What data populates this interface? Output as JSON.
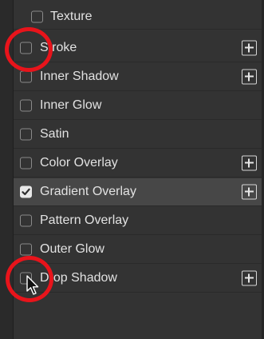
{
  "layer_style_list": {
    "items": [
      {
        "label": "Texture",
        "checked": false,
        "has_add": false,
        "selected": false,
        "sub": true
      },
      {
        "label": "Stroke",
        "checked": false,
        "has_add": true,
        "selected": false,
        "sub": false
      },
      {
        "label": "Inner Shadow",
        "checked": false,
        "has_add": true,
        "selected": false,
        "sub": false
      },
      {
        "label": "Inner Glow",
        "checked": false,
        "has_add": false,
        "selected": false,
        "sub": false
      },
      {
        "label": "Satin",
        "checked": false,
        "has_add": false,
        "selected": false,
        "sub": false
      },
      {
        "label": "Color Overlay",
        "checked": false,
        "has_add": true,
        "selected": false,
        "sub": false
      },
      {
        "label": "Gradient Overlay",
        "checked": true,
        "has_add": true,
        "selected": true,
        "sub": false
      },
      {
        "label": "Pattern Overlay",
        "checked": false,
        "has_add": false,
        "selected": false,
        "sub": false
      },
      {
        "label": "Outer Glow",
        "checked": false,
        "has_add": false,
        "selected": false,
        "sub": false
      },
      {
        "label": "Drop Shadow",
        "checked": false,
        "has_add": true,
        "selected": false,
        "sub": false
      }
    ]
  },
  "icons": {
    "add": "plus-square-icon",
    "check": "checkmark-icon",
    "cursor": "arrow-cursor-icon"
  },
  "colors": {
    "panel_bg": "#333333",
    "selected_bg": "#474747",
    "text": "#e2e2e2",
    "annotation": "#e8141b"
  }
}
